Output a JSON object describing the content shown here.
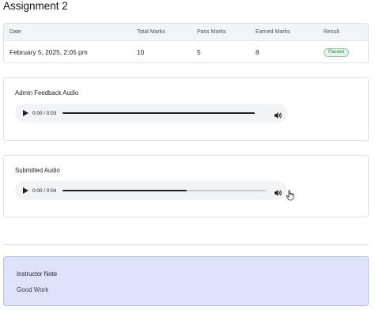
{
  "page": {
    "title": "Assignment 2"
  },
  "results": {
    "headers": {
      "date": "Date",
      "total": "Total Marks",
      "pass": "Pass Marks",
      "earned": "Earned Marks",
      "result": "Result"
    },
    "row": {
      "date": "February 5, 2025, 2:05 pm",
      "total": "10",
      "pass": "5",
      "earned": "8",
      "result": "Passed"
    }
  },
  "admin_audio": {
    "title": "Admin Feedback Audio",
    "time": "0:00 / 0:03",
    "progress": 1.0,
    "play_icon": "play-icon",
    "volume_icon": "volume-icon"
  },
  "submitted_audio": {
    "title": "Submitted Audio",
    "time": "0:00 / 0:04",
    "progress": 0.61,
    "play_icon": "play-icon",
    "volume_icon": "volume-icon"
  },
  "note": {
    "title": "Instructor Note",
    "text": "Good Work"
  },
  "colors": {
    "note_bg": "#dfe2fb",
    "badge_green": "#2f7d45"
  }
}
